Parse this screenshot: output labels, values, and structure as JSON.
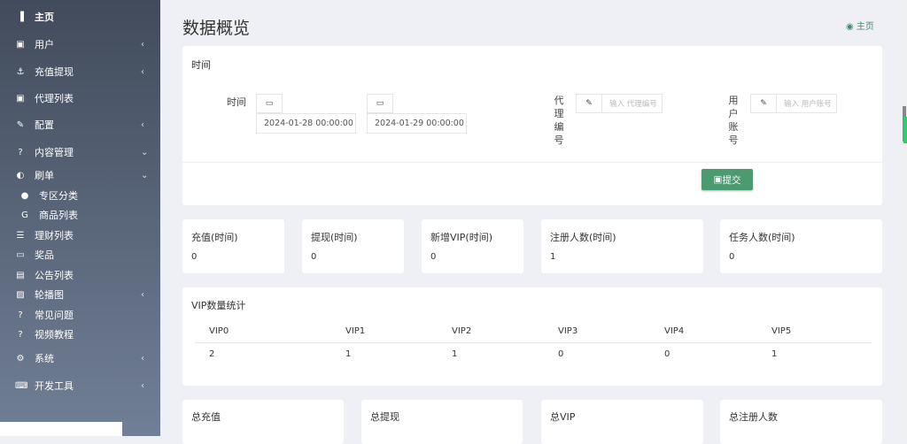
{
  "sidebar": {
    "items": [
      {
        "icon": "bar-chart-icon",
        "glyph": "▐",
        "label": "主页",
        "chev": ""
      },
      {
        "icon": "user-icon",
        "glyph": "▣",
        "label": "用户",
        "chev": "‹"
      },
      {
        "icon": "anchor-icon",
        "glyph": "⚓",
        "label": "充值提现",
        "chev": "‹"
      },
      {
        "icon": "user-card-icon",
        "glyph": "▣",
        "label": "代理列表",
        "chev": ""
      },
      {
        "icon": "wrench-icon",
        "glyph": "✎",
        "label": "配置",
        "chev": "‹"
      },
      {
        "icon": "question-circle-icon",
        "glyph": "?",
        "label": "内容管理",
        "chev": "⌄"
      },
      {
        "icon": "adjust-icon",
        "glyph": "◐",
        "label": "刷单",
        "chev": "⌄"
      },
      {
        "icon": "circle-icon",
        "glyph": "●",
        "label": "专区分类",
        "chev": ""
      },
      {
        "icon": "google-icon",
        "glyph": "G",
        "label": "商品列表",
        "chev": ""
      },
      {
        "icon": "indent-icon",
        "glyph": "☰",
        "label": "理财列表",
        "chev": ""
      },
      {
        "icon": "money-icon",
        "glyph": "▭",
        "label": "奖品",
        "chev": ""
      },
      {
        "icon": "file-text-icon",
        "glyph": "▤",
        "label": "公告列表",
        "chev": ""
      },
      {
        "icon": "image-icon",
        "glyph": "▨",
        "label": "轮播图",
        "chev": "‹"
      },
      {
        "icon": "question-icon",
        "glyph": "?",
        "label": "常见问题",
        "chev": ""
      },
      {
        "icon": "question-icon",
        "glyph": "?",
        "label": "视频教程",
        "chev": ""
      },
      {
        "icon": "gear-icon",
        "glyph": "⚙",
        "label": "系统",
        "chev": "‹"
      },
      {
        "icon": "keyboard-icon",
        "glyph": "⌨",
        "label": "开发工具",
        "chev": "‹"
      }
    ]
  },
  "header": {
    "title": "数据概览",
    "breadcrumb": "主页"
  },
  "filter": {
    "title": "时间",
    "time_label": "时间",
    "start": "2024-01-28 00:00:00",
    "end": "2024-01-29 00:00:00",
    "agent_label": [
      "代",
      "理",
      "编",
      "号"
    ],
    "agent_placeholder": "输入 代理编号",
    "user_label": [
      "用",
      "户",
      "账",
      "号"
    ],
    "user_placeholder": "输入 用户账号",
    "submit": "提交"
  },
  "stats": [
    {
      "label": "充值(时间)",
      "value": "0"
    },
    {
      "label": "提现(时间)",
      "value": "0"
    },
    {
      "label": "新增VIP(时间)",
      "value": "0"
    },
    {
      "label": "注册人数(时间)",
      "value": "1"
    },
    {
      "label": "任务人数(时间)",
      "value": "0"
    }
  ],
  "vip": {
    "title": "VIP数量统计",
    "headers": [
      "VIP0",
      "VIP1",
      "VIP2",
      "VIP3",
      "VIP4",
      "VIP5"
    ],
    "values": [
      "2",
      "1",
      "1",
      "0",
      "0",
      "1"
    ]
  },
  "totals": [
    "总充值",
    "总提现",
    "总VIP",
    "总注册人数"
  ],
  "colors": {
    "accent": "#4b9a70",
    "sidebar_top": "#414b5b",
    "sidebar_bottom": "#717f96"
  }
}
